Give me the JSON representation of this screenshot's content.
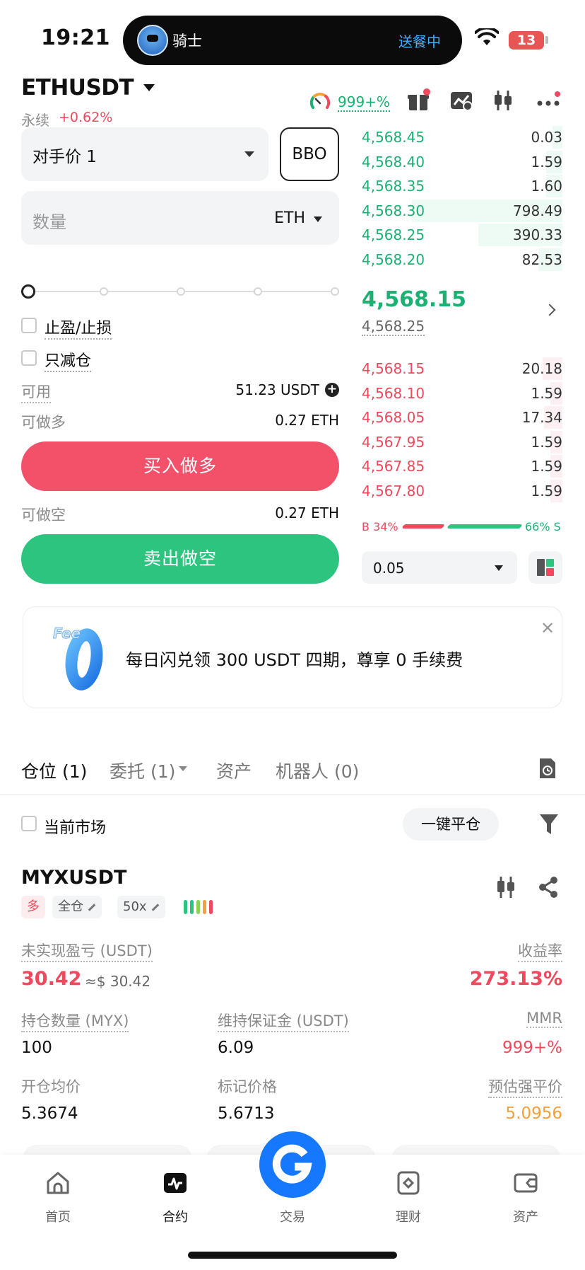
{
  "status_bar": {
    "time": "19:21",
    "battery": "13"
  },
  "island": {
    "name": "骑士",
    "status": "送餐中"
  },
  "header": {
    "pair": "ETHUSDT",
    "contract_type": "永续",
    "change": "+0.62%",
    "ratio": "999+%"
  },
  "order_form": {
    "price_type": "对手价 1",
    "bbo_label": "BBO",
    "quantity_placeholder": "数量",
    "quantity_unit": "ETH",
    "tp_sl_label": "止盈/止损",
    "reduce_only_label": "只减仓",
    "available_label": "可用",
    "available_value": "51.23 USDT",
    "max_long_label": "可做多",
    "max_long_value": "0.27 ETH",
    "buy_label": "买入做多",
    "max_short_label": "可做空",
    "max_short_value": "0.27 ETH",
    "sell_label": "卖出做空"
  },
  "order_book": {
    "asks": [
      {
        "price": "4,568.45",
        "qty": "0.03",
        "depth": 0.05
      },
      {
        "price": "4,568.40",
        "qty": "1.59",
        "depth": 0.08
      },
      {
        "price": "4,568.35",
        "qty": "1.60",
        "depth": 0.08
      },
      {
        "price": "4,568.30",
        "qty": "798.49",
        "depth": 0.75
      },
      {
        "price": "4,568.25",
        "qty": "390.33",
        "depth": 0.42
      },
      {
        "price": "4,568.20",
        "qty": "82.53",
        "depth": 0.12
      }
    ],
    "mid_price": "4,568.15",
    "mark_price": "4,568.25",
    "bids": [
      {
        "price": "4,568.15",
        "qty": "20.18",
        "depth": 0.1
      },
      {
        "price": "4,568.10",
        "qty": "1.59",
        "depth": 0.06
      },
      {
        "price": "4,568.05",
        "qty": "17.34",
        "depth": 0.09
      },
      {
        "price": "4,567.95",
        "qty": "1.59",
        "depth": 0.06
      },
      {
        "price": "4,567.85",
        "qty": "1.59",
        "depth": 0.06
      },
      {
        "price": "4,567.80",
        "qty": "1.59",
        "depth": 0.06
      }
    ],
    "buy_ratio_label": "B 34%",
    "sell_ratio_label": "66% S",
    "depth_step": "0.05"
  },
  "banner": {
    "logo_text": "Fee",
    "text": "每日闪兑领 300 USDT 四期，尊享 0 手续费"
  },
  "tabs": [
    {
      "label": "仓位 (1)"
    },
    {
      "label": "委托 (1)"
    },
    {
      "label": "资产"
    },
    {
      "label": "机器人 (0)"
    }
  ],
  "filter": {
    "current_market": "当前市场",
    "close_all": "一键平仓"
  },
  "position": {
    "symbol": "MYXUSDT",
    "side": "多",
    "margin_mode": "全仓",
    "leverage": "50x",
    "unrealized_pnl_label": "未实现盈亏 (USDT)",
    "unrealized_pnl": "30.42",
    "unrealized_pnl_usd": "≈$ 30.42",
    "roe_label": "收益率",
    "roe": "273.13%",
    "size_label": "持仓数量 (MYX)",
    "size": "100",
    "maint_margin_label": "维持保证金 (USDT)",
    "maint_margin": "6.09",
    "mmr_label": "MMR",
    "mmr": "999+%",
    "entry_label": "开仓均价",
    "entry": "5.3674",
    "mark_label": "标记价格",
    "mark": "5.6713",
    "liq_label": "预估强平价",
    "liq": "5.0956"
  },
  "nav": [
    {
      "label": "首页",
      "icon": "home-icon"
    },
    {
      "label": "合约",
      "icon": "futures-icon"
    },
    {
      "label": "交易",
      "icon": "trade-icon"
    },
    {
      "label": "理财",
      "icon": "earn-icon"
    },
    {
      "label": "资产",
      "icon": "assets-icon"
    }
  ],
  "colors": {
    "green": "#1ab173",
    "red": "#f0485c",
    "orange": "#f5a03c",
    "blue": "#1677ff"
  }
}
